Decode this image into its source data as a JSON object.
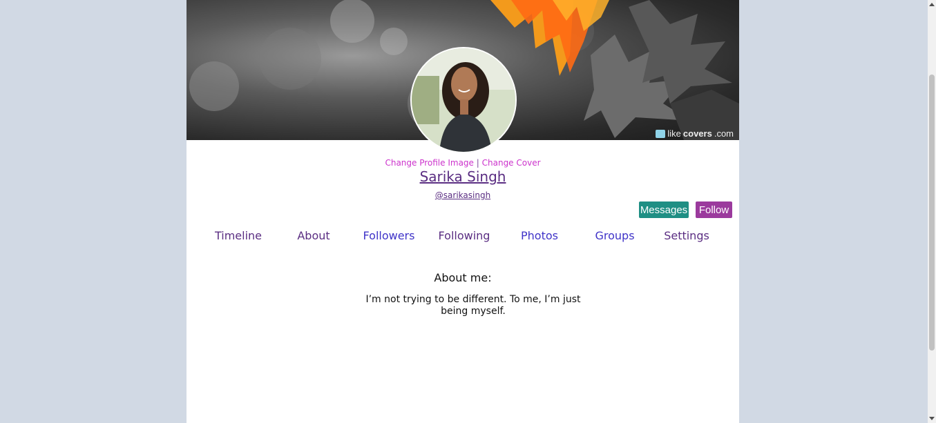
{
  "cover": {
    "watermark_prefix": "like",
    "watermark_brand": "covers",
    "watermark_suffix": ".com",
    "image_icon": "autumn-leaves-cover-image"
  },
  "profile": {
    "avatar_icon": "profile-photo",
    "change_profile_image": "Change Profile Image",
    "separator": "|",
    "change_cover": "Change Cover",
    "name": "Sarika Singh",
    "handle": "@sarikasingh"
  },
  "actions": {
    "messages": "Messages",
    "follow": "Follow"
  },
  "nav": {
    "items": [
      {
        "label": "Timeline"
      },
      {
        "label": "About"
      },
      {
        "label": "Followers"
      },
      {
        "label": "Following"
      },
      {
        "label": "Photos"
      },
      {
        "label": "Groups"
      },
      {
        "label": "Settings"
      }
    ]
  },
  "about": {
    "title": "About me:",
    "text": "I’m not trying to be different. To me, I’m just being myself."
  },
  "colors": {
    "page_bg": "#d1d9e4",
    "messages_btn": "#1f8f84",
    "follow_btn": "#9b3a9d",
    "link_pink": "#cc33cc",
    "nav_blue": "#3f33c8",
    "visited_purple": "#5a2d82"
  }
}
